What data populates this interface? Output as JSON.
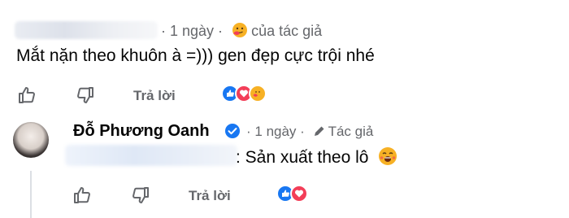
{
  "comment1": {
    "time": "1 ngày",
    "author_badge": "của tác giả",
    "text": "Mắt nặn theo khuôn à =))) gen đẹp cực trội nhé",
    "reply_label": "Trả lời",
    "reactions": [
      "like",
      "love",
      "care"
    ]
  },
  "comment2": {
    "author_name": "Đỗ Phương Oanh",
    "time": "1 ngày",
    "author_badge": "Tác giả",
    "text": "Sản xuất theo lô",
    "reply_label": "Trả lời",
    "reactions": [
      "like",
      "love"
    ]
  },
  "colors": {
    "like_blue": "#1877f2",
    "love_red": "#f33e58",
    "care_yellow": "#f7b125",
    "secondary_text": "#65676b"
  }
}
